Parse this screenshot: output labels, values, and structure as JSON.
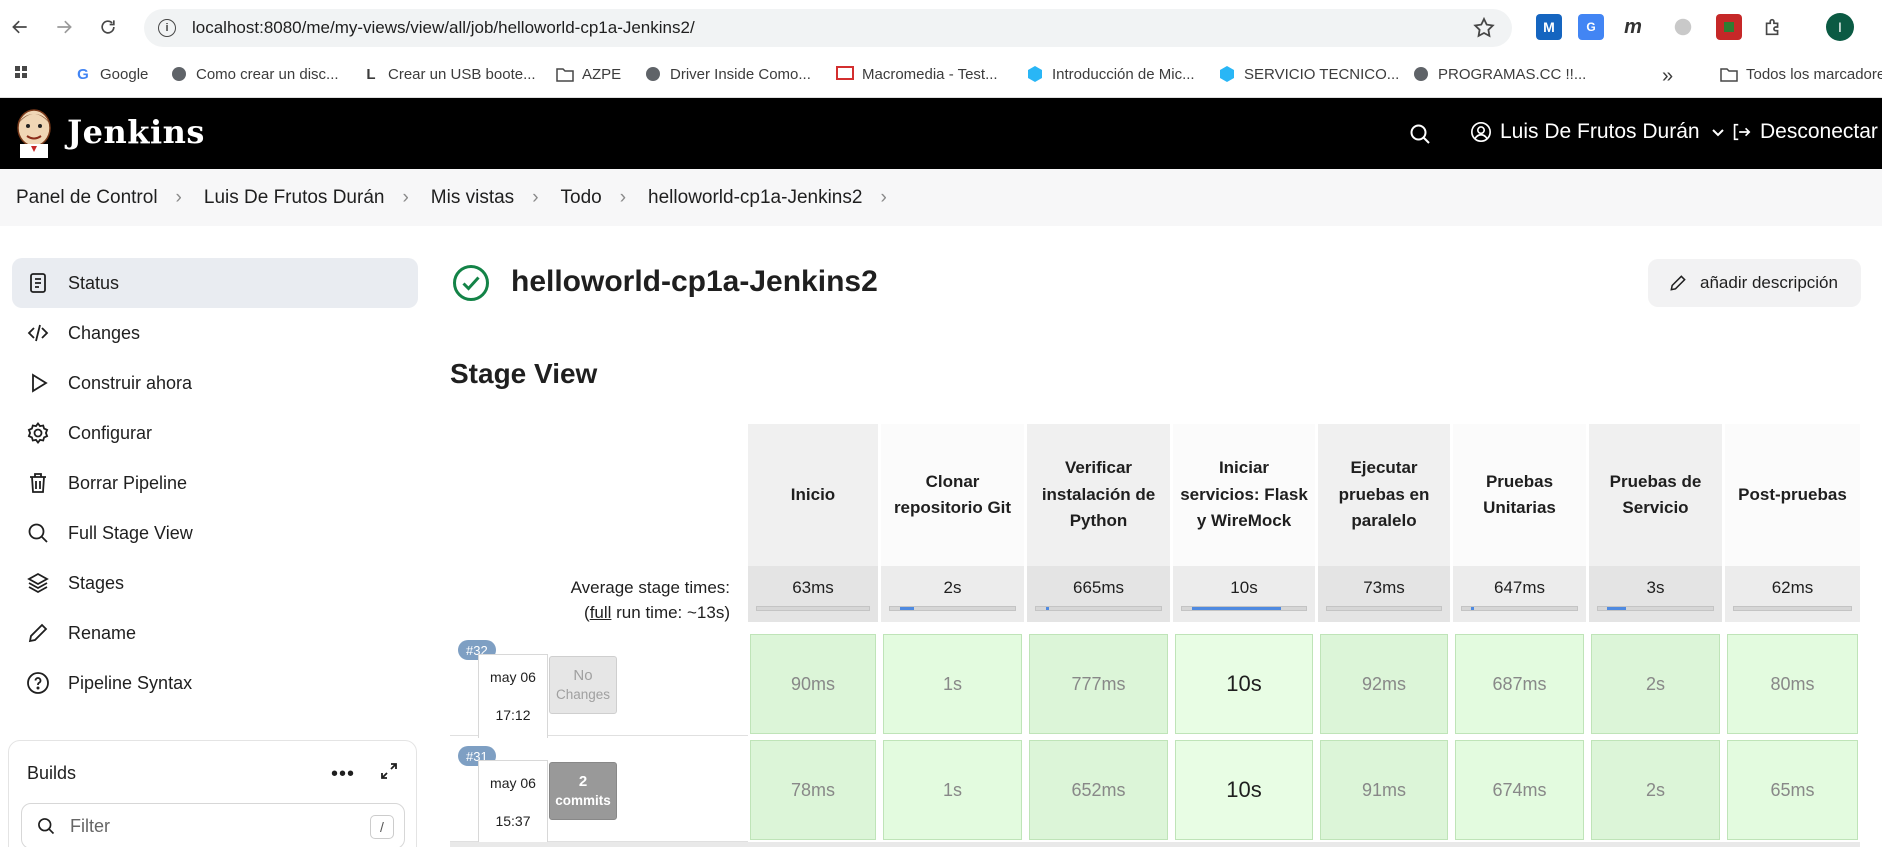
{
  "browser": {
    "url": "localhost:8080/me/my-views/view/all/job/helloworld-cp1a-Jenkins2/",
    "profile_initial": "I",
    "bookmarks": [
      {
        "label": "Google",
        "icon": "google-icon"
      },
      {
        "label": "Como crear un disc...",
        "icon": "globe-icon"
      },
      {
        "label": "Crear un USB boote...",
        "icon": "site-icon"
      },
      {
        "label": "AZPE",
        "icon": "folder-icon"
      },
      {
        "label": "Driver Inside Como...",
        "icon": "globe-icon"
      },
      {
        "label": "Macromedia - Test...",
        "icon": "site-icon"
      },
      {
        "label": "Introducción de Mic...",
        "icon": "site-icon"
      },
      {
        "label": "SERVICIO TECNICO...",
        "icon": "site-icon"
      },
      {
        "label": "PROGRAMAS.CC !!...",
        "icon": "globe-icon"
      }
    ],
    "more_bookmarks": "»",
    "all_bookmarks": "Todos los marcadores"
  },
  "header": {
    "brand": "Jenkins",
    "user": "Luis De Frutos Durán",
    "logout": "Desconectar"
  },
  "breadcrumb": [
    "Panel de Control",
    "Luis De Frutos Durán",
    "Mis vistas",
    "Todo",
    "helloworld-cp1a-Jenkins2"
  ],
  "sidebar": {
    "items": [
      {
        "label": "Status",
        "icon": "status-icon",
        "active": true
      },
      {
        "label": "Changes",
        "icon": "code-icon"
      },
      {
        "label": "Construir ahora",
        "icon": "play-icon"
      },
      {
        "label": "Configurar",
        "icon": "gear-icon"
      },
      {
        "label": "Borrar Pipeline",
        "icon": "trash-icon"
      },
      {
        "label": "Full Stage View",
        "icon": "search-icon"
      },
      {
        "label": "Stages",
        "icon": "layers-icon"
      },
      {
        "label": "Rename",
        "icon": "pencil-icon"
      },
      {
        "label": "Pipeline Syntax",
        "icon": "help-icon"
      }
    ],
    "builds": {
      "title": "Builds",
      "more": "•••",
      "filter_placeholder": "Filter",
      "filter_shortcut": "/"
    }
  },
  "main": {
    "job_title": "helloworld-cp1a-Jenkins2",
    "add_description": "añadir descripción",
    "stage_view_title": "Stage View",
    "avg_label_1": "Average stage times:",
    "avg_label_2_pre": "(",
    "avg_label_2_link": "full",
    "avg_label_2_post": " run time: ~13s)",
    "stages": [
      {
        "name": "Inicio",
        "avg": "63ms",
        "fill": 0.0
      },
      {
        "name": "Clonar repositorio Git",
        "avg": "2s",
        "fill": 0.12
      },
      {
        "name": "Verificar instalación de Python",
        "avg": "665ms",
        "fill": 0.03
      },
      {
        "name": "Iniciar servicios: Flask y WireMock",
        "avg": "10s",
        "fill": 0.8
      },
      {
        "name": "Ejecutar pruebas en paralelo",
        "avg": "73ms",
        "fill": 0.0
      },
      {
        "name": "Pruebas Unitarias",
        "avg": "647ms",
        "fill": 0.03
      },
      {
        "name": "Pruebas de Servicio",
        "avg": "3s",
        "fill": 0.18
      },
      {
        "name": "Post-pruebas",
        "avg": "62ms",
        "fill": 0.0
      }
    ],
    "runs": [
      {
        "badge": "#32",
        "date": "may 06",
        "time": "17:12",
        "changes_type": "none",
        "changes_line1": "No",
        "changes_line2": "Changes",
        "durations": [
          "90ms",
          "1s",
          "777ms",
          "10s",
          "92ms",
          "687ms",
          "2s",
          "80ms"
        ]
      },
      {
        "badge": "#31",
        "date": "may 06",
        "time": "15:37",
        "changes_type": "commits",
        "changes_line1": "2",
        "changes_line2": "commits",
        "durations": [
          "78ms",
          "1s",
          "652ms",
          "10s",
          "91ms",
          "674ms",
          "2s",
          "65ms"
        ]
      }
    ]
  },
  "colors": {
    "header_bg": "#000000",
    "success_green": "#138347",
    "cell_green": "#dcf5d8",
    "badge_blue": "#7e9fc3",
    "progress_blue": "#4f8ae0"
  }
}
